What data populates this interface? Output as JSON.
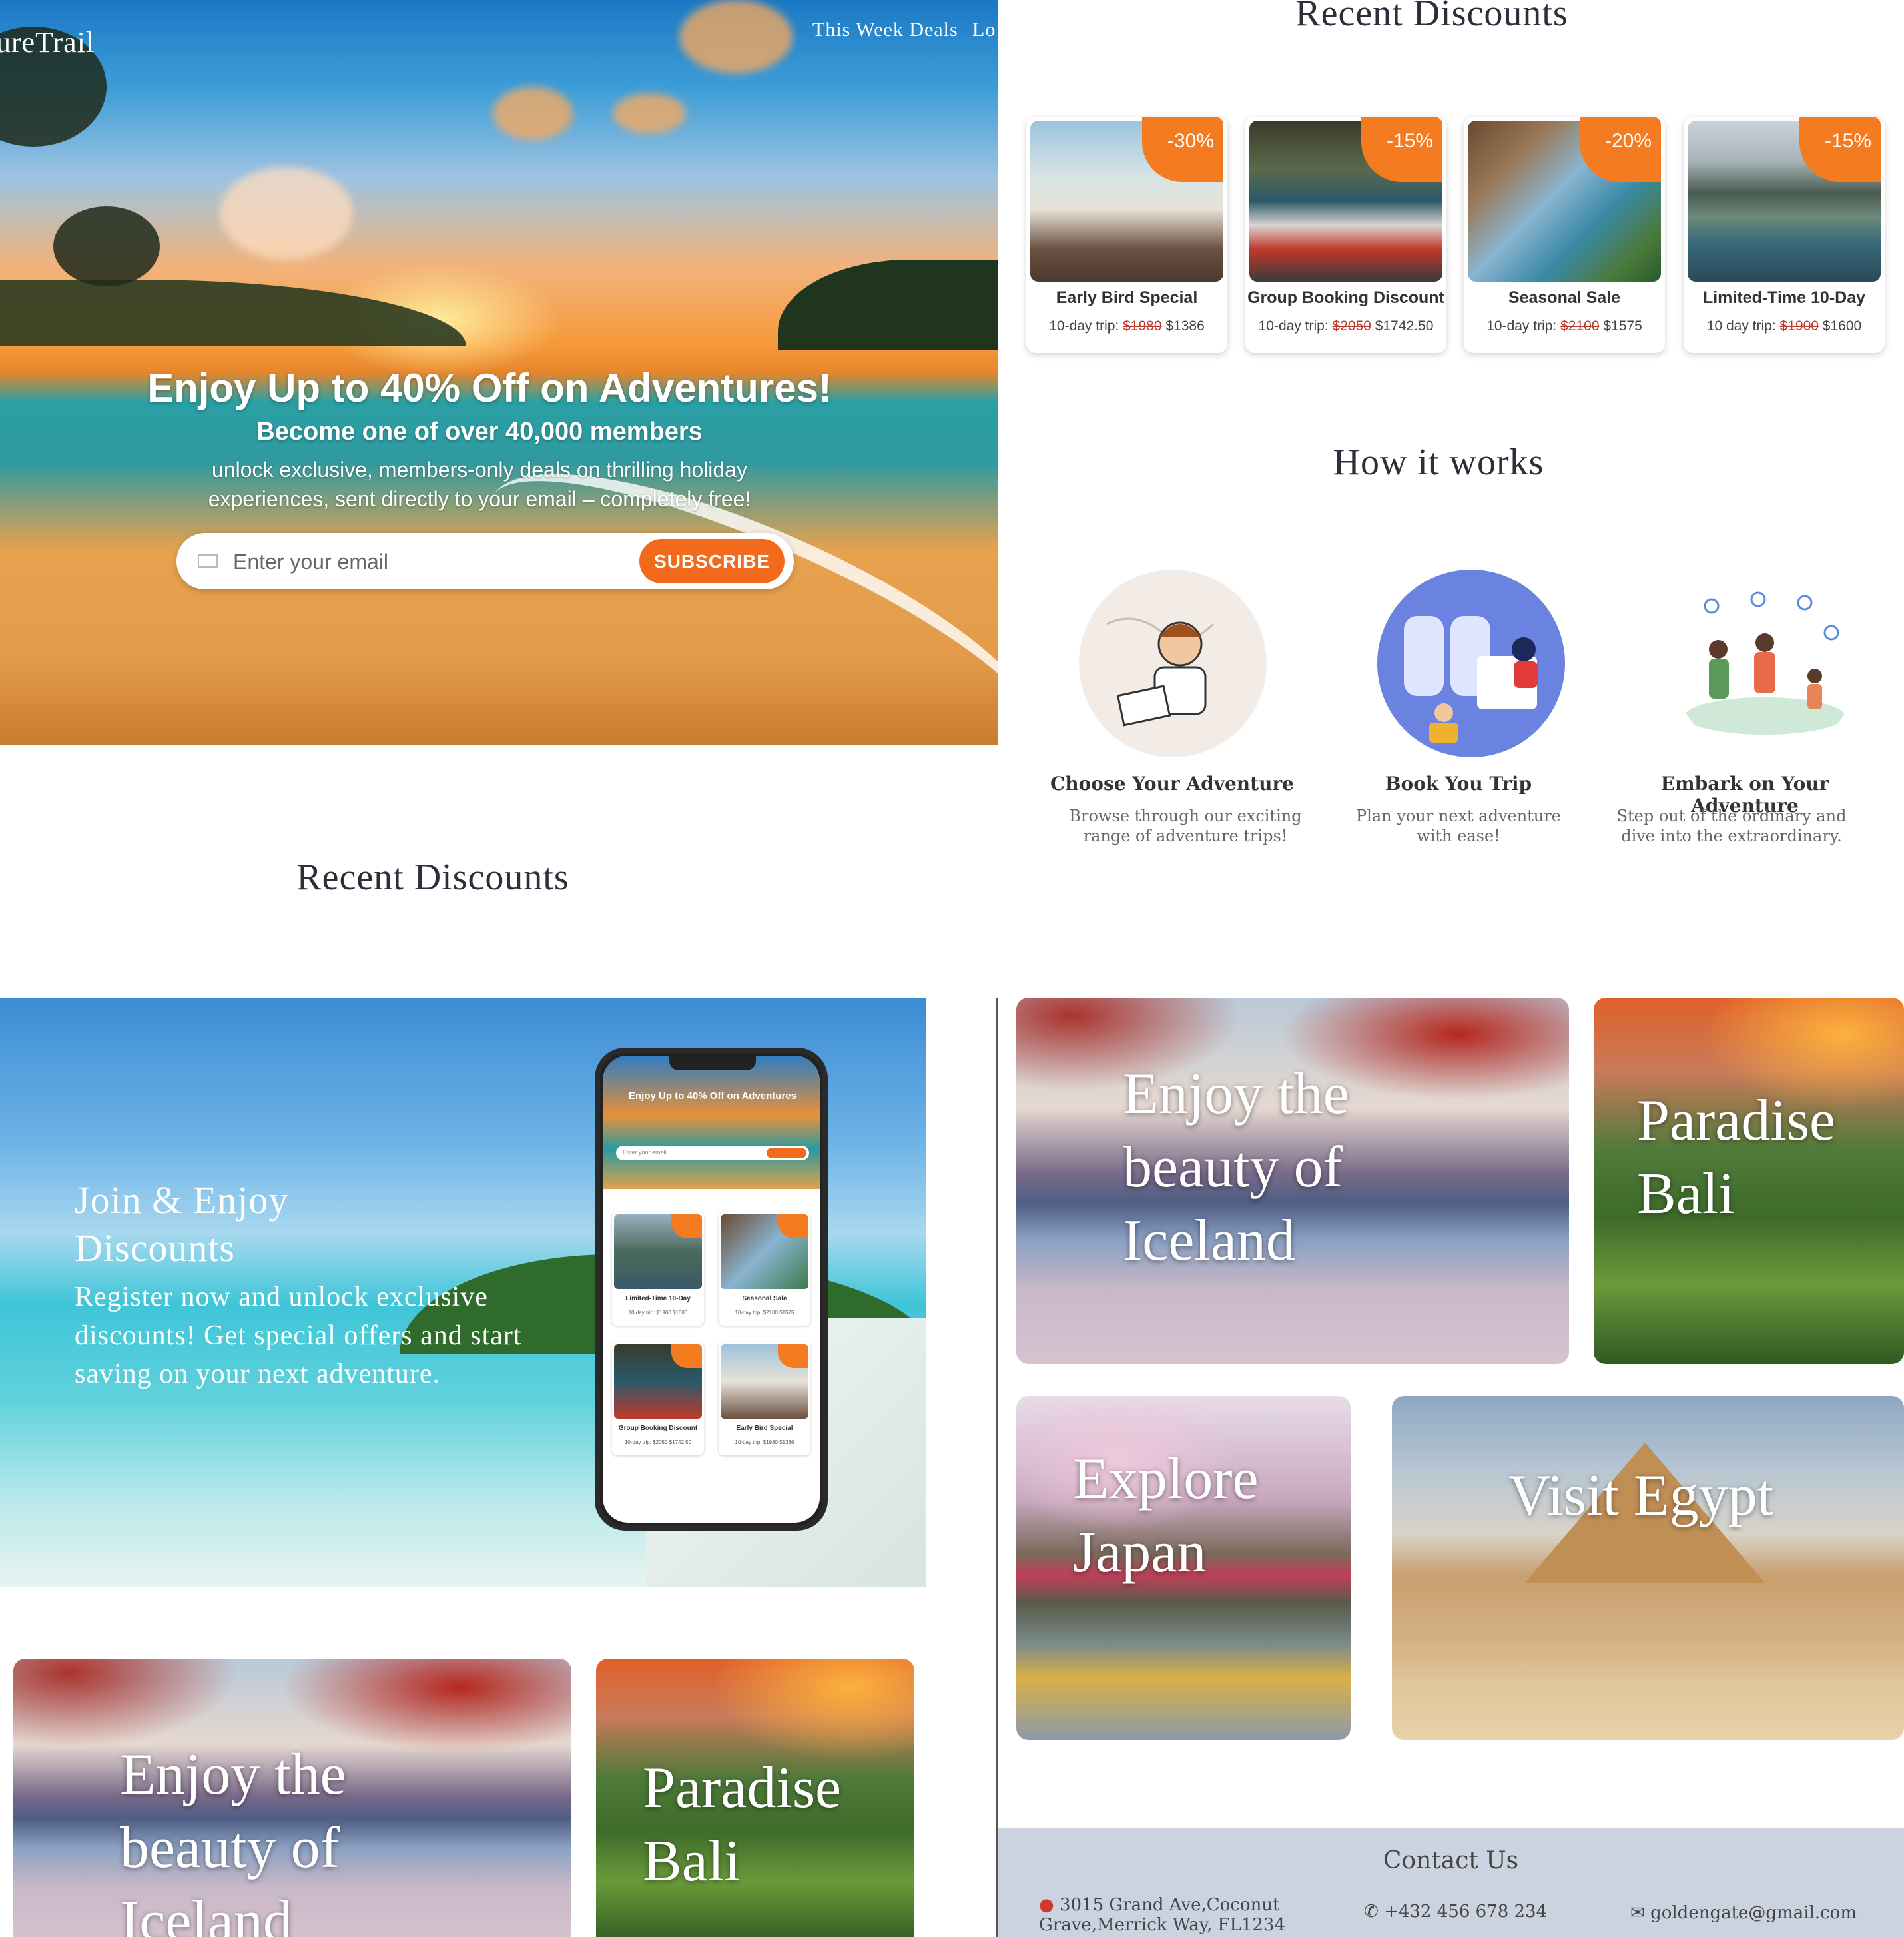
{
  "hero": {
    "brand": "ureTrail",
    "nav": [
      "This Week Deals",
      "Lo"
    ],
    "headline": "Enjoy Up to 40% Off on Adventures!",
    "subheadline": "Become one of over 40,000 members",
    "description": "unlock exclusive, members-only deals on thrilling holiday experiences, sent directly to your email – completely free!",
    "email_placeholder": "Enter your email",
    "email_value": "",
    "subscribe_label": "SUBSCRIBE"
  },
  "recent_discounts": {
    "title": "Recent Discounts",
    "cards": [
      {
        "badge": "-30%",
        "name": "Early Bird Special",
        "prefix": "10-day trip:",
        "old_price": "$1980",
        "new_price": "$1386"
      },
      {
        "badge": "-15%",
        "name": "Group Booking Discount",
        "prefix": "10-day trip:",
        "old_price": "$2050",
        "new_price": "$1742.50"
      },
      {
        "badge": "-20%",
        "name": "Seasonal Sale",
        "prefix": "10-day trip:",
        "old_price": "$2100",
        "new_price": "$1575"
      },
      {
        "badge": "-15%",
        "name": "Limited-Time 10-Day",
        "prefix": "10 day trip:",
        "old_price": "$1900",
        "new_price": "$1600"
      }
    ]
  },
  "how_it_works": {
    "title": "How it works",
    "steps": [
      {
        "title": "Choose Your Adventure",
        "desc": "Browse through our exciting range of adventure trips!",
        "icon": "support-agent-illustration"
      },
      {
        "title": "Book You Trip",
        "desc": "Plan your next adventure with ease!",
        "icon": "booking-illustration"
      },
      {
        "title": "Embark on Your Adventure",
        "desc": "Step out of the ordinary and dive into the extraordinary.",
        "icon": "travelers-illustration"
      }
    ]
  },
  "recent_discounts_mid": {
    "title": "Recent Discounts"
  },
  "join": {
    "title": "Join & Enjoy Discounts",
    "description": "Register now and unlock exclusive discounts! Get special offers and start saving on your next adventure.",
    "phone": {
      "headline": "Enjoy Up to 40% Off on Adventures",
      "input_placeholder": "Enter your email",
      "cards": [
        {
          "name": "Limited-Time 10-Day",
          "price": "10 day trip: $1900 $1600"
        },
        {
          "name": "Seasonal Sale",
          "price": "10-day trip: $2100 $1575"
        },
        {
          "name": "Group Booking Discount",
          "price": "10-day trip: $2050 $1742.50"
        },
        {
          "name": "Early Bird Special",
          "price": "10-day trip: $1980 $1386"
        }
      ]
    }
  },
  "destinations": {
    "iceland": "Enjoy the beauty of Iceland",
    "bali": "Paradise Bali",
    "japan": "Explore Japan",
    "egypt": "Visit Egypt"
  },
  "footer": {
    "title": "Contact Us",
    "address": "3015 Grand Ave,Coconut Grave,Merrick Way, FL1234",
    "phone": "+432 456 678 234",
    "email": "goldengate@gmail.com"
  },
  "colors": {
    "accent": "#f26b1d",
    "badge": "#f47b20",
    "footer_bg": "#cbd3e0",
    "strike_price": "#c0392b"
  }
}
